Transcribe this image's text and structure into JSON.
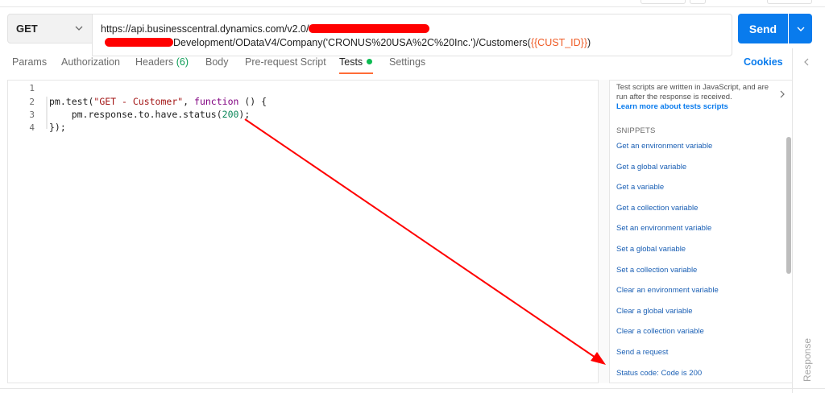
{
  "request": {
    "method": "GET",
    "url_line1": "https://api.businesscentral.dynamics.com/v2.0/",
    "url_line2_mid": "Development/ODataV4/Company('CRONUS%20USA%2C%20Inc.')/Customers(",
    "url_var": "{{CUST_ID}}",
    "url_line2_end": ")",
    "send_label": "Send"
  },
  "tabs": {
    "params": "Params",
    "authorization": "Authorization",
    "headers": "Headers",
    "headers_count": "(6)",
    "body": "Body",
    "prerequest": "Pre-request Script",
    "tests": "Tests",
    "settings": "Settings",
    "cookies": "Cookies"
  },
  "editor": {
    "line_numbers": [
      "1",
      "2",
      "3",
      "4"
    ],
    "line2_a": "pm.test(",
    "line2_str": "\"GET - Customer\"",
    "line2_b": ", ",
    "line2_kw": "function",
    "line2_c": " () {",
    "line3_a": "    pm.response.to.have.status(",
    "line3_num": "200",
    "line3_b": ");",
    "line4": "});"
  },
  "snippets": {
    "description": "Test scripts are written in JavaScript, and are run after the response is received.",
    "learn_more": "Learn more about tests scripts",
    "heading": "SNIPPETS",
    "items": [
      "Get an environment variable",
      "Get a global variable",
      "Get a variable",
      "Get a collection variable",
      "Set an environment variable",
      "Set a global variable",
      "Set a collection variable",
      "Clear an environment variable",
      "Clear a global variable",
      "Clear a collection variable",
      "Send a request",
      "Status code: Code is 200"
    ]
  },
  "response_label": "Response",
  "colors": {
    "accent": "#097bed",
    "active_tab": "#ff6c37",
    "annotation_arrow": "#ff0000"
  }
}
